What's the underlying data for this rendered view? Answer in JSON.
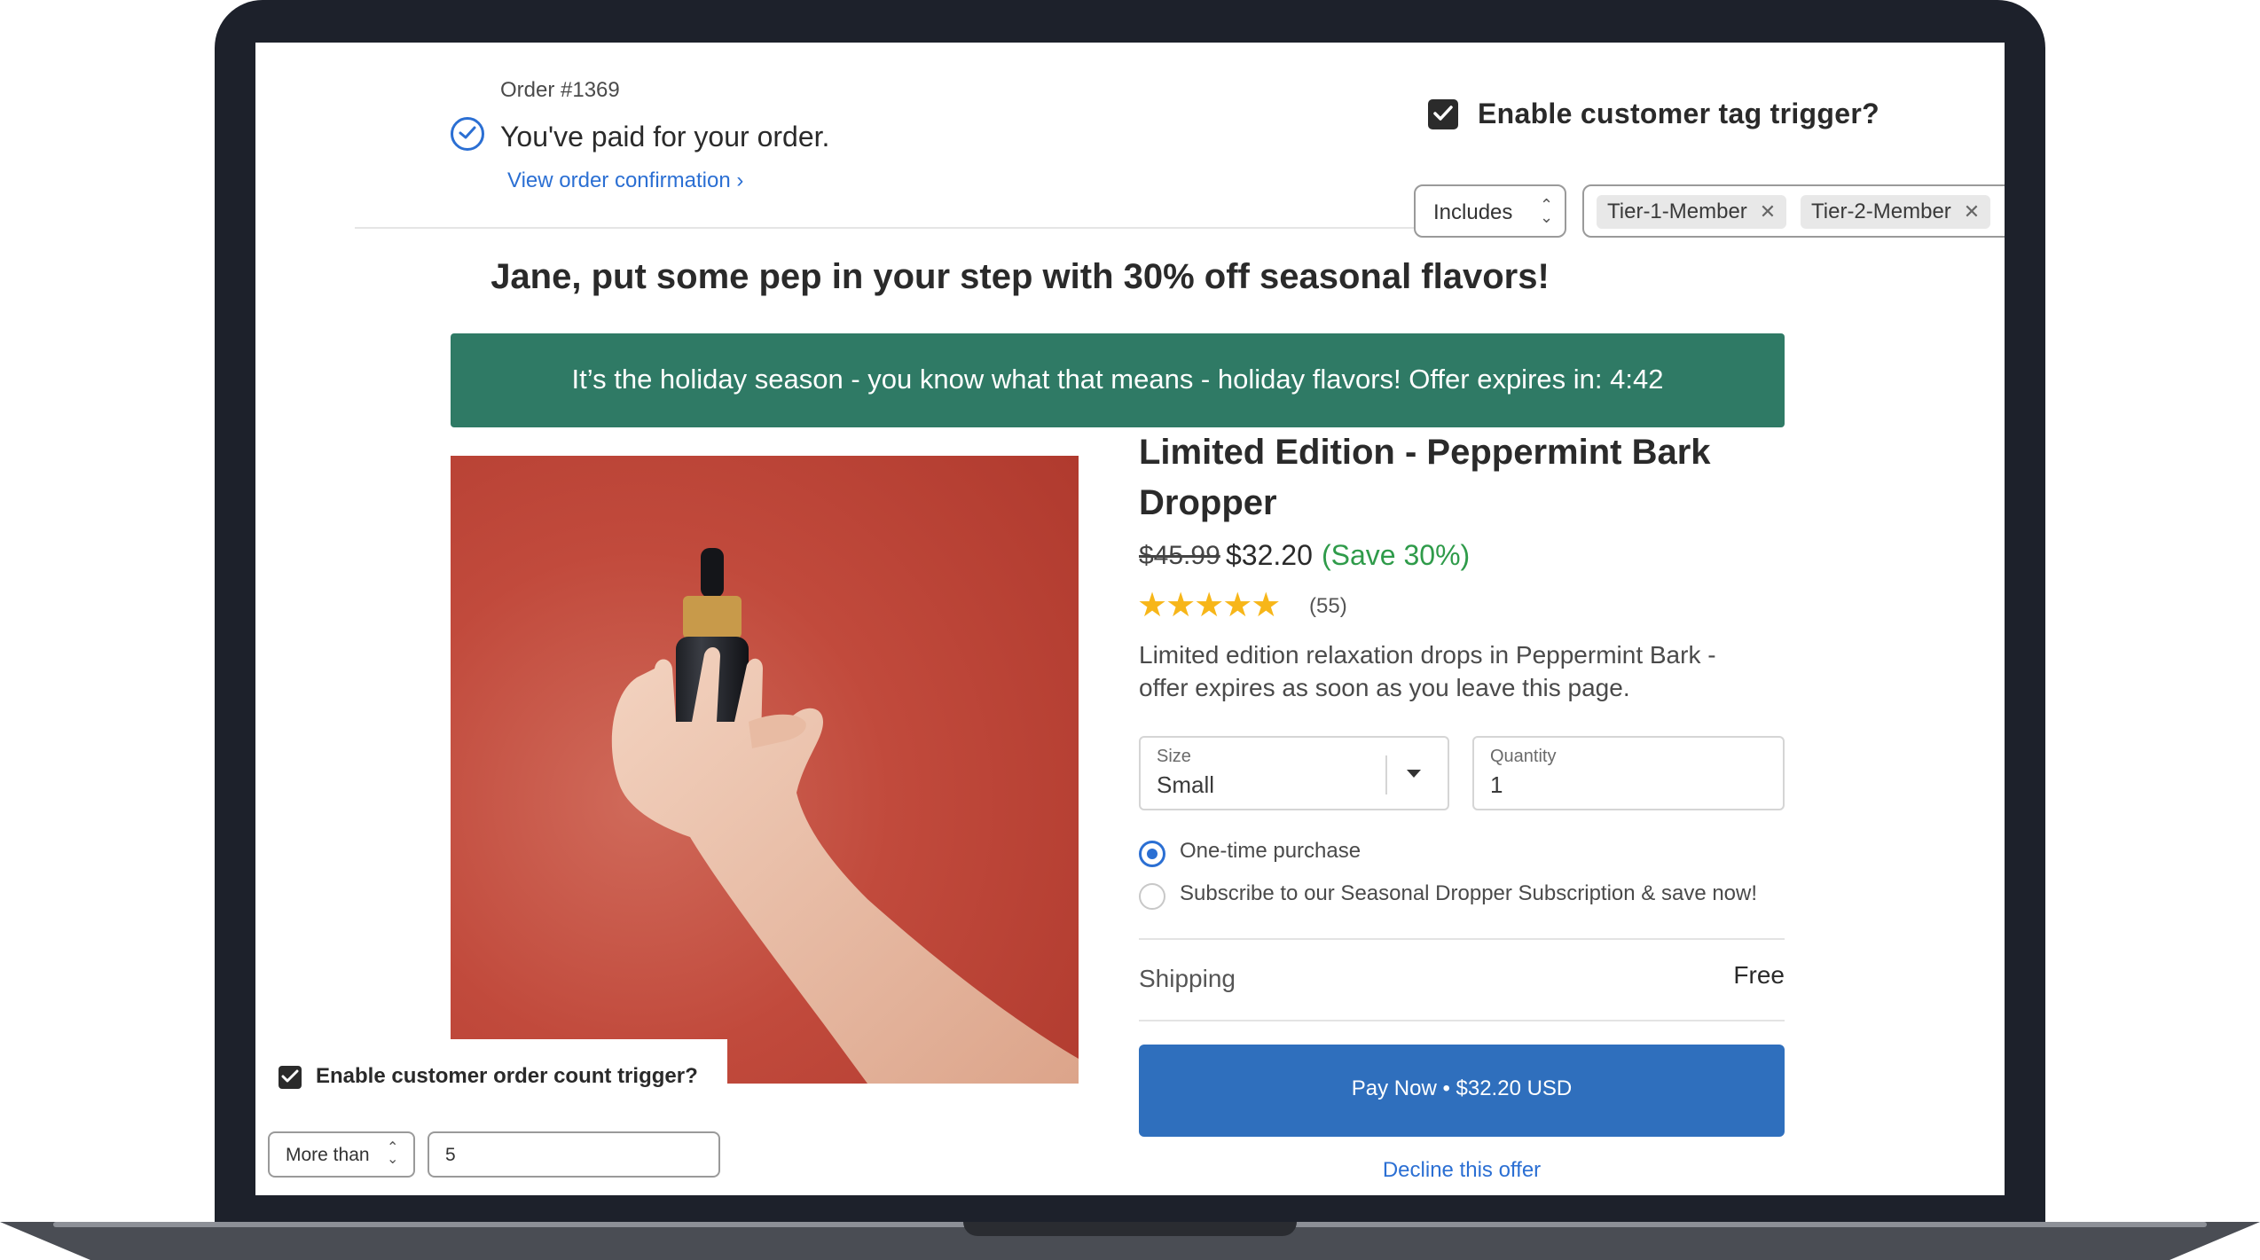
{
  "order": {
    "number": "Order #1369",
    "paid_message": "You've paid for your order.",
    "view_confirmation": "View order confirmation ›"
  },
  "tag_trigger": {
    "label": "Enable customer tag trigger?",
    "checked": true,
    "operator": "Includes",
    "tags": [
      "Tier-1-Member",
      "Tier-2-Member"
    ]
  },
  "offer": {
    "headline": "Jane, put some pep in your step with 30% off seasonal flavors!",
    "banner": "It’s the holiday season - you know what that means - holiday flavors! Offer expires in: 4:42",
    "banner_color": "#2f7a65"
  },
  "product": {
    "title": "Limited Edition - Peppermint Bark Dropper",
    "price_original": "$45.99",
    "price_sale": "$32.20",
    "savings": "(Save 30%)",
    "rating_stars": 4.5,
    "stars_display": "★★★★★",
    "rating_count": "(55)",
    "description": "Limited edition relaxation drops in Peppermint Bark - offer expires as soon as you leave this page.",
    "size": {
      "label": "Size",
      "value": "Small"
    },
    "quantity": {
      "label": "Quantity",
      "value": "1"
    },
    "purchase_options": [
      {
        "label": "One-time purchase",
        "selected": true
      },
      {
        "label": "Subscribe to our Seasonal Dropper Subscription & save now!",
        "selected": false
      }
    ],
    "shipping": {
      "label": "Shipping",
      "value": "Free"
    },
    "pay_button": "Pay Now • $32.20 USD",
    "pay_button_color": "#2f6fbd",
    "decline": "Decline this offer"
  },
  "order_count_trigger": {
    "label": "Enable customer order count trigger?",
    "checked": true,
    "operator": "More than",
    "value": "5"
  }
}
